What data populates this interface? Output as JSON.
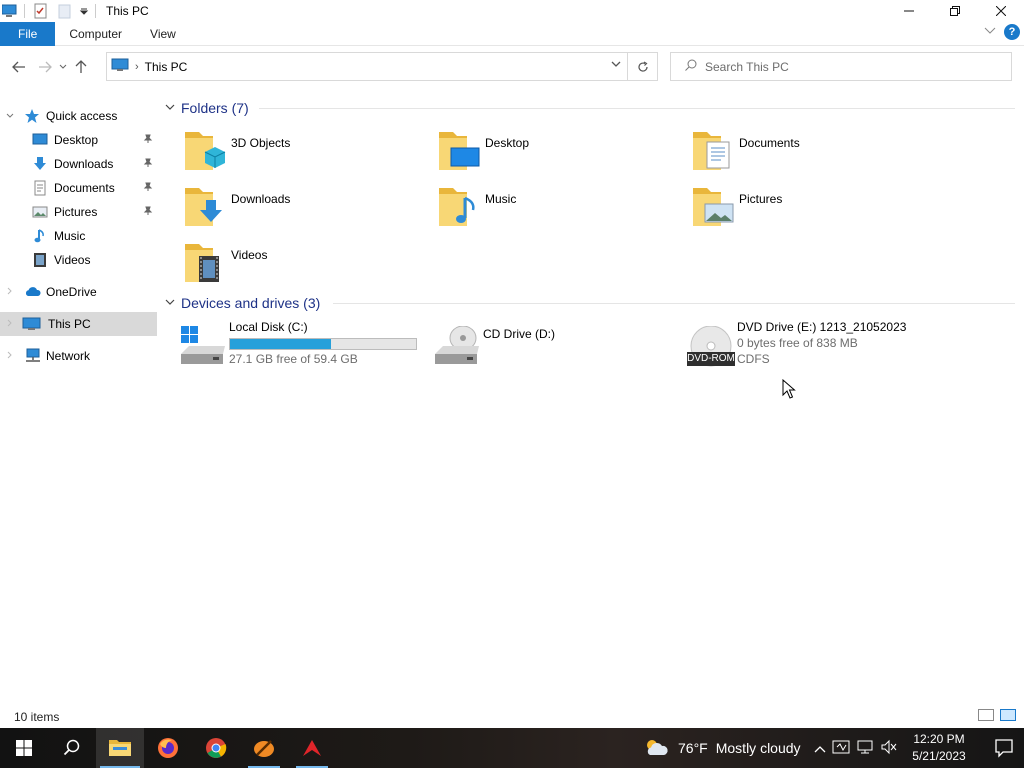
{
  "window": {
    "title": "This PC"
  },
  "ribbon": {
    "tabs": [
      "File",
      "Computer",
      "View"
    ],
    "help": "?"
  },
  "address": {
    "crumb": "This PC",
    "separator": "›"
  },
  "search": {
    "placeholder": "Search This PC"
  },
  "nav_pane": {
    "items": [
      {
        "label": "Quick access",
        "icon": "star-icon"
      },
      {
        "label": "Desktop",
        "icon": "desktop-icon",
        "pinned": true
      },
      {
        "label": "Downloads",
        "icon": "download-icon",
        "pinned": true
      },
      {
        "label": "Documents",
        "icon": "document-icon",
        "pinned": true
      },
      {
        "label": "Pictures",
        "icon": "picture-icon",
        "pinned": true
      },
      {
        "label": "Music",
        "icon": "music-icon"
      },
      {
        "label": "Videos",
        "icon": "video-icon"
      },
      {
        "label": "OneDrive",
        "icon": "cloud-icon"
      },
      {
        "label": "This PC",
        "icon": "computer-icon",
        "selected": true
      },
      {
        "label": "Network",
        "icon": "network-icon"
      }
    ]
  },
  "folders": {
    "header": "Folders (7)",
    "items": [
      "3D Objects",
      "Desktop",
      "Documents",
      "Downloads",
      "Music",
      "Pictures",
      "Videos"
    ]
  },
  "devices": {
    "header": "Devices and drives (3)",
    "items": [
      {
        "label": "Local Disk (C:)",
        "sub": "27.1 GB free of 59.4 GB",
        "used_fraction": 0.544
      },
      {
        "label": "CD Drive (D:)"
      },
      {
        "label": "DVD Drive (E:) 1213_21052023",
        "sub": "0 bytes free of 838 MB",
        "sub2": "CDFS",
        "badge": "DVD-ROM"
      }
    ]
  },
  "status": {
    "item_count": "10 items"
  },
  "taskbar": {
    "weather": {
      "temp": "76°F",
      "condition": "Mostly cloudy"
    },
    "clock": {
      "time": "12:20 PM",
      "date": "5/21/2023"
    }
  },
  "colors": {
    "accent": "#1979ca",
    "header_text": "#1e3287",
    "progress": "#26a0da",
    "selected_nav": "#d9d9d9"
  }
}
